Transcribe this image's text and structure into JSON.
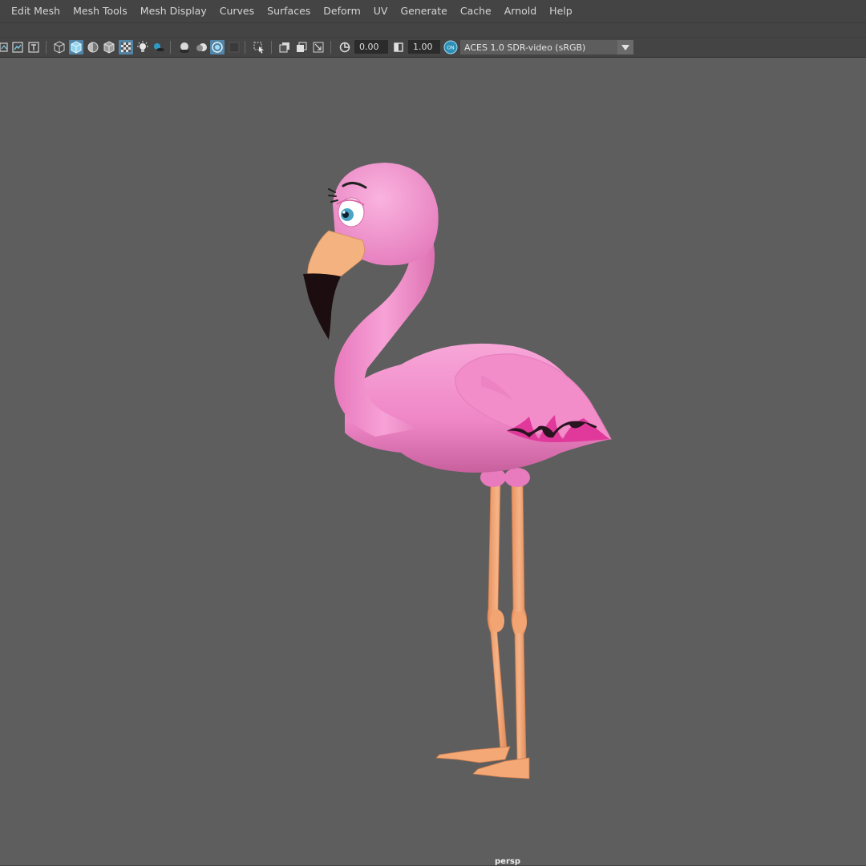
{
  "menubar": {
    "items": [
      "Edit Mesh",
      "Mesh Tools",
      "Mesh Display",
      "Curves",
      "Surfaces",
      "Deform",
      "UV",
      "Generate",
      "Cache",
      "Arnold",
      "Help"
    ]
  },
  "toolbar": {
    "exposure_value": "0.00",
    "gamma_value": "1.00",
    "color_space": "ACES 1.0 SDR-video (sRGB)",
    "icons": [
      "select-camera-icon",
      "image-plane-icon",
      "text-icon",
      "wireframe-icon",
      "smooth-shade-icon",
      "flat-shade-icon",
      "bounding-box-icon",
      "xray-icon",
      "lights-icon",
      "shadows-icon",
      "ambient-occlusion-icon",
      "motion-blur-icon",
      "antialiasing-icon",
      "depth-of-field-icon",
      "isolate-select-icon",
      "xray-joints-icon",
      "xray-active-icon",
      "backface-icon",
      "exposure-icon",
      "gamma-icon",
      "color-management-icon"
    ]
  },
  "viewport": {
    "camera": "persp",
    "background": "#5e5e5e",
    "subject": "flamingo-model"
  },
  "colors": {
    "accent": "#5285a6",
    "flamingo_pink": "#f08cc8",
    "leg_orange": "#f0a070",
    "beak_black": "#1a0e0e"
  }
}
